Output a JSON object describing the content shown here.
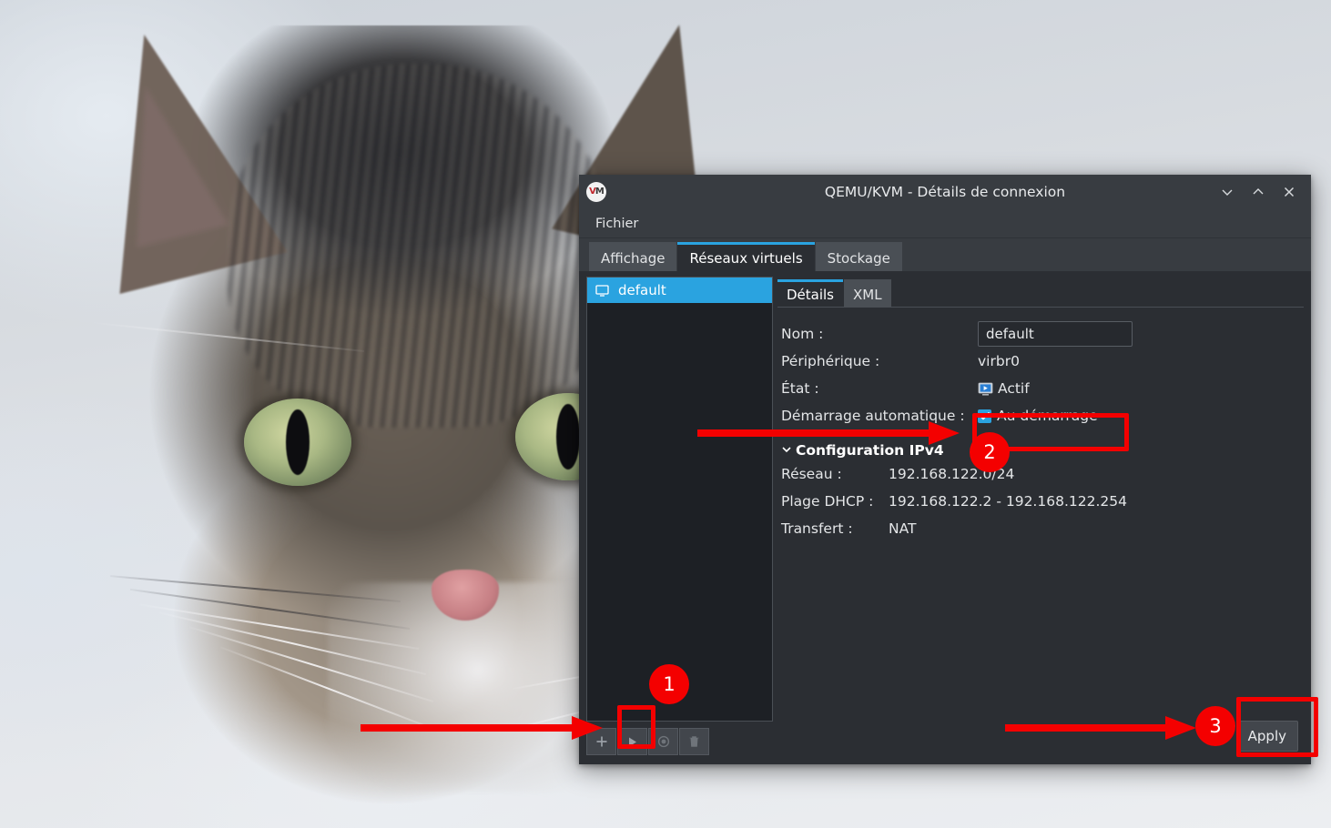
{
  "window": {
    "title": "QEMU/KVM - Détails de connexion",
    "app_icon": "vm-logo-icon",
    "logo_v": "V",
    "logo_m": "M",
    "controls": {
      "minimize": "minimize-icon",
      "maximize": "maximize-icon",
      "close": "close-icon"
    }
  },
  "menubar": {
    "items": [
      {
        "label": "Fichier"
      }
    ]
  },
  "tabs": [
    {
      "label": "Affichage",
      "active": false
    },
    {
      "label": "Réseaux virtuels",
      "active": true
    },
    {
      "label": "Stockage",
      "active": false
    }
  ],
  "network_list": {
    "items": [
      {
        "label": "default",
        "selected": true,
        "icon": "network-screen-icon"
      }
    ]
  },
  "network_toolbar": {
    "buttons": [
      {
        "name": "add-network-button",
        "icon": "plus-icon",
        "enabled": true
      },
      {
        "name": "start-network-button",
        "icon": "play-icon",
        "enabled": true
      },
      {
        "name": "stop-network-button",
        "icon": "stop-circle-icon",
        "enabled": false
      },
      {
        "name": "delete-network-button",
        "icon": "trash-icon",
        "enabled": false
      }
    ]
  },
  "subtabs": [
    {
      "label": "Détails",
      "active": true
    },
    {
      "label": "XML",
      "active": false
    }
  ],
  "details": {
    "name_label": "Nom :",
    "name_value": "default",
    "name_placeholder": "default",
    "device_label": "Périphérique :",
    "device_value": "virbr0",
    "state_label": "État :",
    "state_value": "Actif",
    "state_icon": "monitor-play-icon",
    "autostart_label": "Démarrage automatique :",
    "autostart_checkbox_label": "Au démarrage",
    "autostart_checked": true,
    "ipv4_section": "Configuration IPv4",
    "ipv4_chevron": "chevron-down-icon",
    "network_label": "Réseau :",
    "network_value": "192.168.122.0/24",
    "dhcp_label": "Plage DHCP :",
    "dhcp_value": "192.168.122.2 - 192.168.122.254",
    "forward_label": "Transfert :",
    "forward_value": "NAT"
  },
  "footer": {
    "apply_label": "Apply"
  },
  "annotations": [
    {
      "badge": "1",
      "target": "start-network-button"
    },
    {
      "badge": "2",
      "target": "autostart-checkbox"
    },
    {
      "badge": "3",
      "target": "apply-button"
    }
  ],
  "colors": {
    "accent": "#2aa3e0",
    "annotation": "#f40000",
    "window_bg": "#383c41",
    "panel_bg": "#2b2e33",
    "list_bg": "#1d2025"
  }
}
